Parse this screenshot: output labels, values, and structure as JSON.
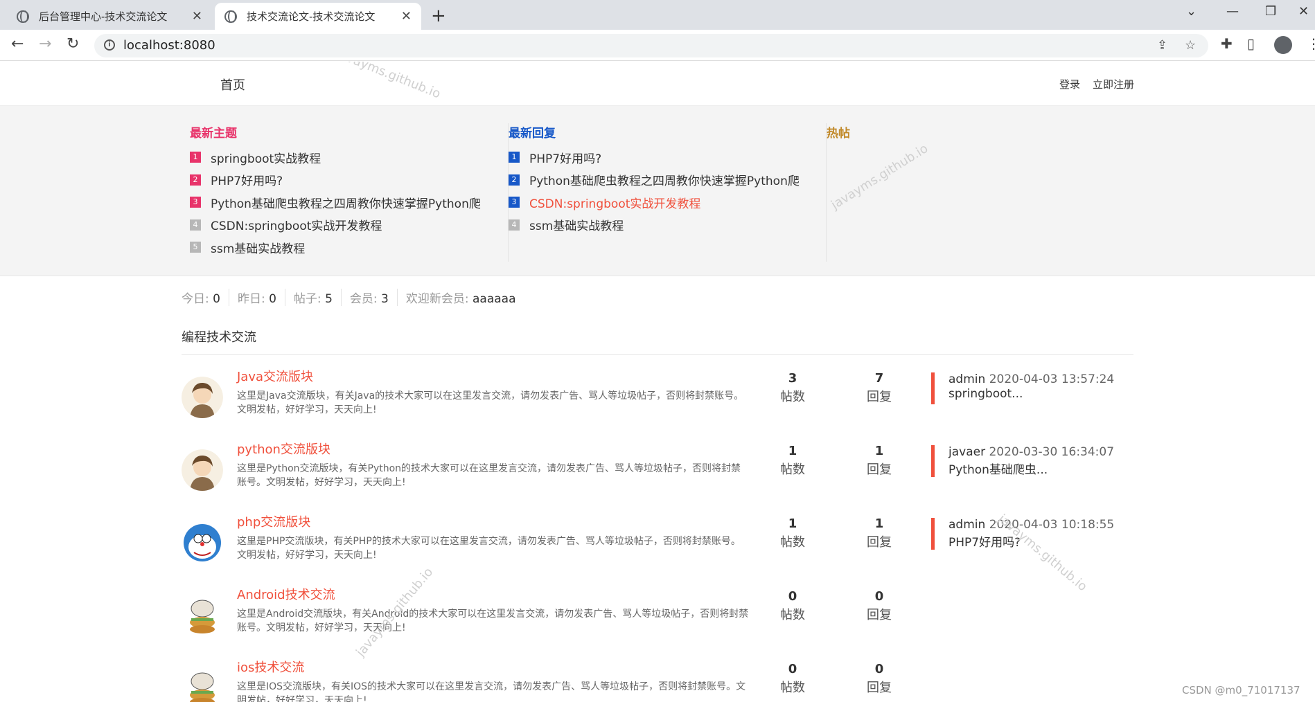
{
  "browser": {
    "tabs": [
      {
        "title": "后台管理中心-技术交流论文",
        "active": false
      },
      {
        "title": "技术交流论文-技术交流论文",
        "active": true
      }
    ],
    "url": "localhost:8080"
  },
  "nav": {
    "home": "首页",
    "login": "登录",
    "register": "立即注册"
  },
  "hot": {
    "latest_topics": {
      "title": "最新主题",
      "items": [
        {
          "rank": "1",
          "text": "springboot实战教程"
        },
        {
          "rank": "2",
          "text": "PHP7好用吗?"
        },
        {
          "rank": "3",
          "text": "Python基础爬虫教程之四周教你快速掌握Python爬"
        },
        {
          "rank": "4",
          "text": "CSDN:springboot实战开发教程"
        },
        {
          "rank": "5",
          "text": "ssm基础实战教程"
        }
      ]
    },
    "latest_replies": {
      "title": "最新回复",
      "items": [
        {
          "rank": "1",
          "text": "PHP7好用吗?"
        },
        {
          "rank": "2",
          "text": "Python基础爬虫教程之四周教你快速掌握Python爬"
        },
        {
          "rank": "3",
          "text": "CSDN:springboot实战开发教程"
        },
        {
          "rank": "4",
          "text": "ssm基础实战教程"
        }
      ]
    },
    "hot_posts": {
      "title": "热帖"
    }
  },
  "stats": {
    "today_label": "今日:",
    "today": "0",
    "yesterday_label": "昨日:",
    "yesterday": "0",
    "posts_label": "帖子:",
    "posts": "5",
    "members_label": "会员:",
    "members": "3",
    "newmember_label": "欢迎新会员:",
    "newmember": "aaaaaa"
  },
  "section_title": "编程技术交流",
  "forums": [
    {
      "name": "Java交流版块",
      "desc": "这里是Java交流版块，有关Java的技术大家可以在这里发言交流，请勿发表广告、骂人等垃圾帖子，否则将封禁账号。文明发帖，好好学习，天天向上!",
      "topics": "3",
      "topics_label": "帖数",
      "replies": "7",
      "replies_label": "回复",
      "last_user": "admin",
      "last_time": "2020-04-03 13:57:24",
      "last_title": "springboot..."
    },
    {
      "name": "python交流版块",
      "desc": "这里是Python交流版块，有关Python的技术大家可以在这里发言交流，请勿发表广告、骂人等垃圾帖子，否则将封禁账号。文明发帖，好好学习，天天向上!",
      "topics": "1",
      "topics_label": "帖数",
      "replies": "1",
      "replies_label": "回复",
      "last_user": "javaer",
      "last_time": "2020-03-30 16:34:07",
      "last_title": "Python基础爬虫..."
    },
    {
      "name": "php交流版块",
      "desc": "这里是PHP交流版块，有关PHP的技术大家可以在这里发言交流，请勿发表广告、骂人等垃圾帖子，否则将封禁账号。文明发帖，好好学习，天天向上!",
      "topics": "1",
      "topics_label": "帖数",
      "replies": "1",
      "replies_label": "回复",
      "last_user": "admin",
      "last_time": "2020-04-03 10:18:55",
      "last_title": "PHP7好用吗?"
    },
    {
      "name": "Android技术交流",
      "desc": "这里是Android交流版块，有关Android的技术大家可以在这里发言交流，请勿发表广告、骂人等垃圾帖子，否则将封禁账号。文明发帖，好好学习，天天向上!",
      "topics": "0",
      "topics_label": "帖数",
      "replies": "0",
      "replies_label": "回复"
    },
    {
      "name": "ios技术交流",
      "desc": "这里是IOS交流版块，有关IOS的技术大家可以在这里发言交流，请勿发表广告、骂人等垃圾帖子，否则将封禁账号。文明发帖，好好学习，天天向上!",
      "topics": "0",
      "topics_label": "帖数",
      "replies": "0",
      "replies_label": "回复"
    }
  ],
  "watermark": "javayms.github.io",
  "csdn_mark": "CSDN @m0_71017137",
  "colors": {
    "accent_red": "#f0503c",
    "topic_pink": "#e8336a",
    "reply_blue": "#1758c8",
    "hot_gold": "#c18a2b"
  }
}
